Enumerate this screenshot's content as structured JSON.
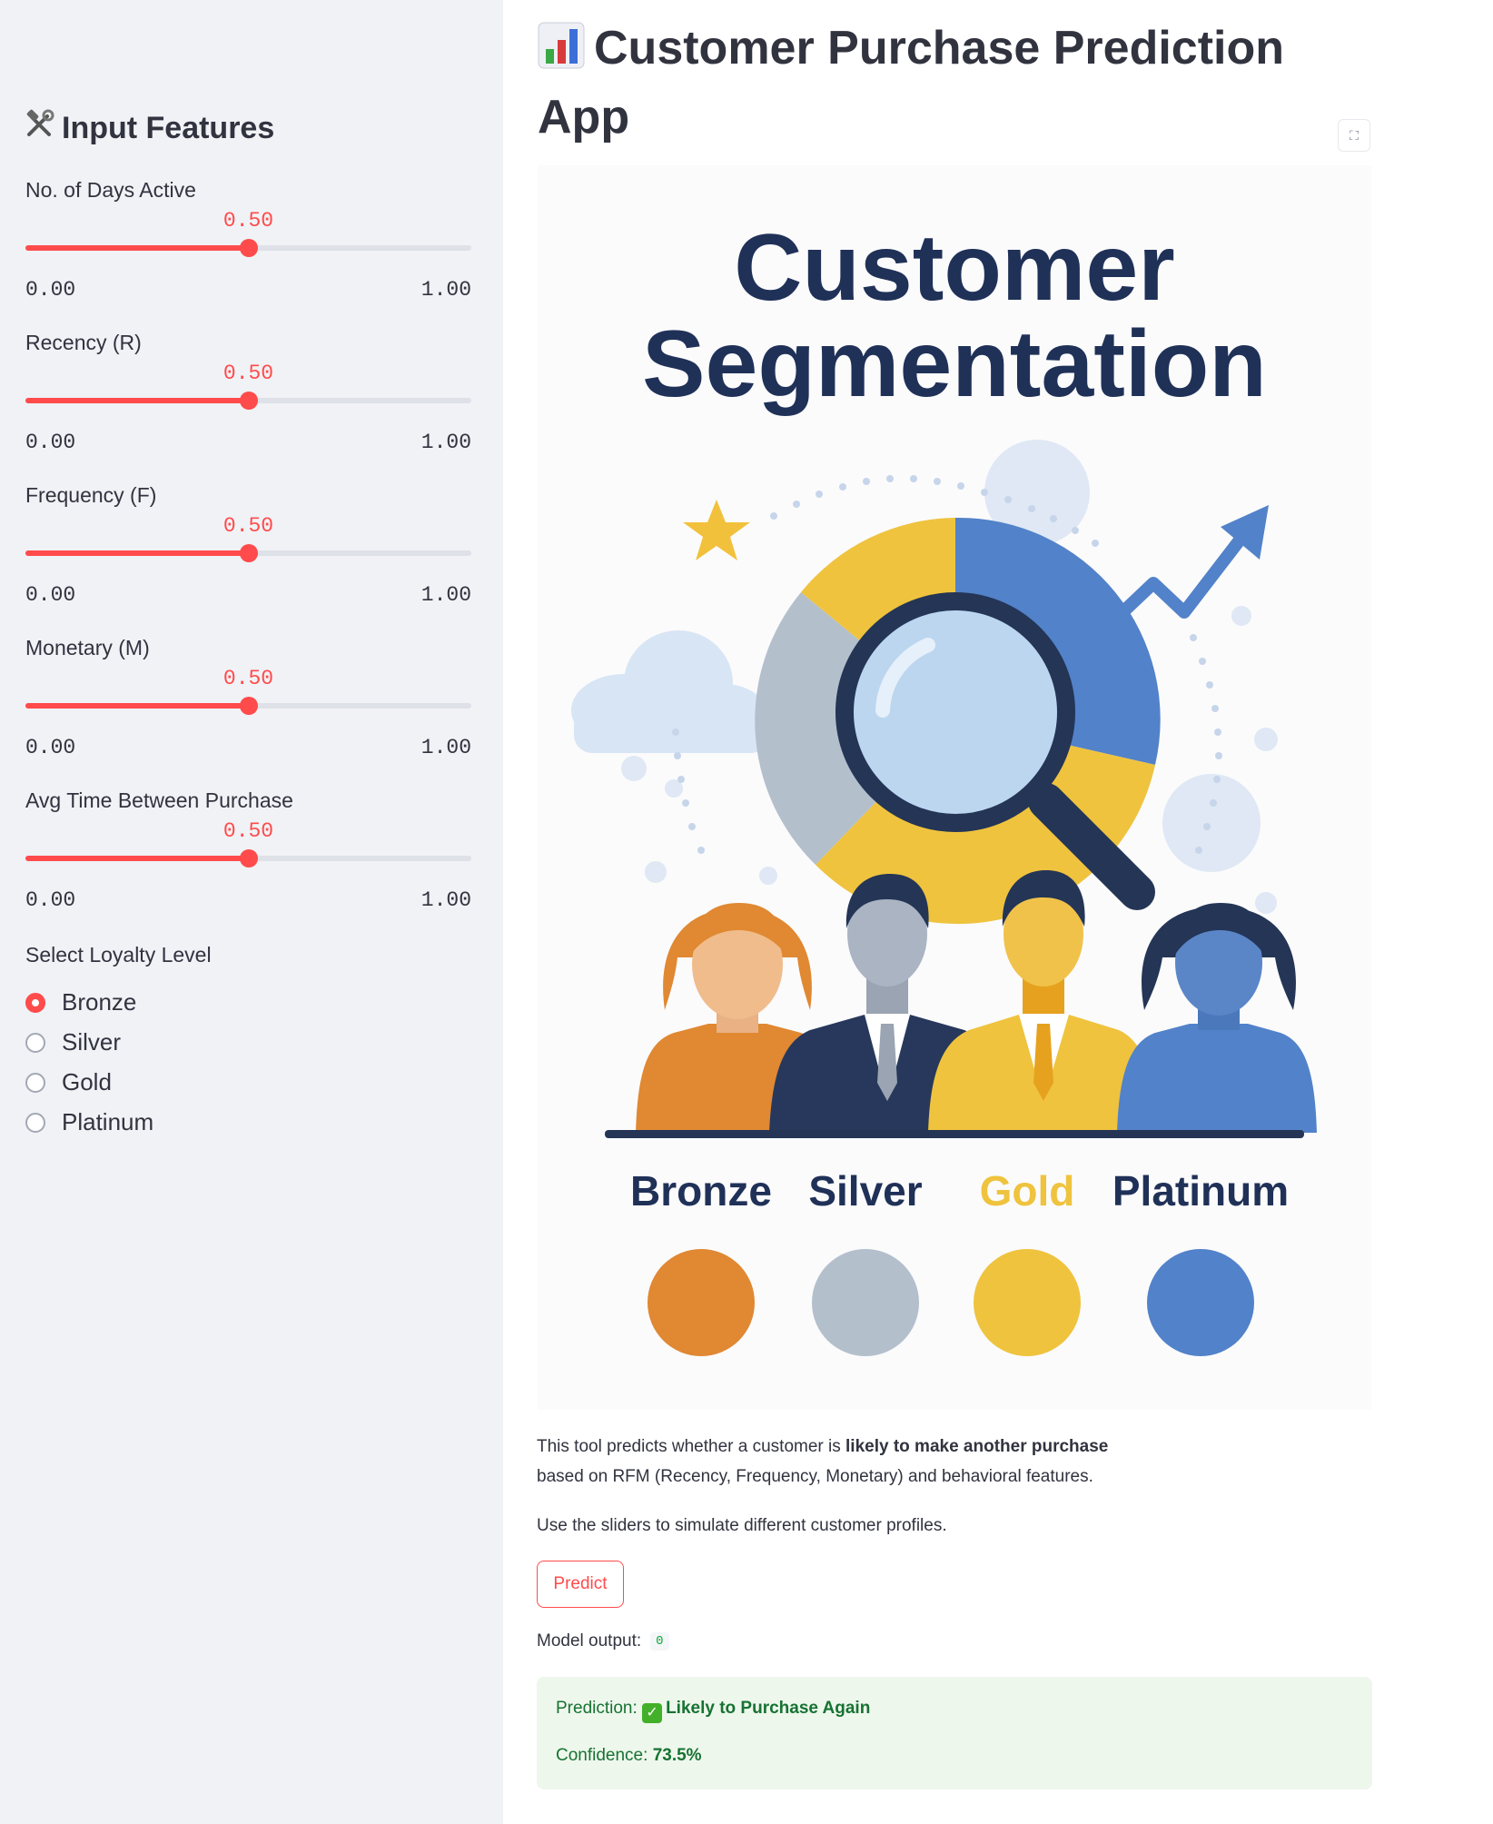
{
  "sidebar": {
    "title": "Input Features",
    "title_icon": "hammer-wrench-icon",
    "sliders": [
      {
        "label": "No. of Days Active",
        "value": "0.50",
        "min": "0.00",
        "max": "1.00",
        "fraction": 0.5
      },
      {
        "label": "Recency (R)",
        "value": "0.50",
        "min": "0.00",
        "max": "1.00",
        "fraction": 0.5
      },
      {
        "label": "Frequency (F)",
        "value": "0.50",
        "min": "0.00",
        "max": "1.00",
        "fraction": 0.5
      },
      {
        "label": "Monetary (M)",
        "value": "0.50",
        "min": "0.00",
        "max": "1.00",
        "fraction": 0.5
      },
      {
        "label": "Avg Time Between Purchase",
        "value": "0.50",
        "min": "0.00",
        "max": "1.00",
        "fraction": 0.5
      }
    ],
    "loyalty": {
      "label": "Select Loyalty Level",
      "options": [
        "Bronze",
        "Silver",
        "Gold",
        "Platinum"
      ],
      "selected": "Bronze"
    }
  },
  "main": {
    "title_icon": "bar-chart-icon",
    "title": "Customer Purchase Prediction App",
    "poster": {
      "heading_line1": "Customer",
      "heading_line2": "Segmentation",
      "segments": [
        {
          "name": "Bronze",
          "color": "#e08832"
        },
        {
          "name": "Silver",
          "color": "#b4bfcc"
        },
        {
          "name": "Gold",
          "color": "#efc33e"
        },
        {
          "name": "Platinum",
          "color": "#5282c9"
        }
      ]
    },
    "description": {
      "line1_prefix": "This tool predicts whether a customer is ",
      "line1_bold": "likely to make another purchase",
      "line2": "based on RFM (Recency, Frequency, Monetary) and behavioral features.",
      "line3": "Use the sliders to simulate different customer profiles."
    },
    "predict_button": "Predict",
    "model_output_label": "Model output:",
    "model_output_value": "0",
    "result": {
      "prediction_label": "Prediction:",
      "prediction_value": "Likely to Purchase Again",
      "confidence_label": "Confidence:",
      "confidence_value": "73.5%"
    }
  },
  "colors": {
    "accent": "#ff4b4b",
    "sidebar_bg": "#f0f2f6",
    "navy": "#203158",
    "success_bg": "#eef7ec",
    "success_text": "#177233"
  }
}
